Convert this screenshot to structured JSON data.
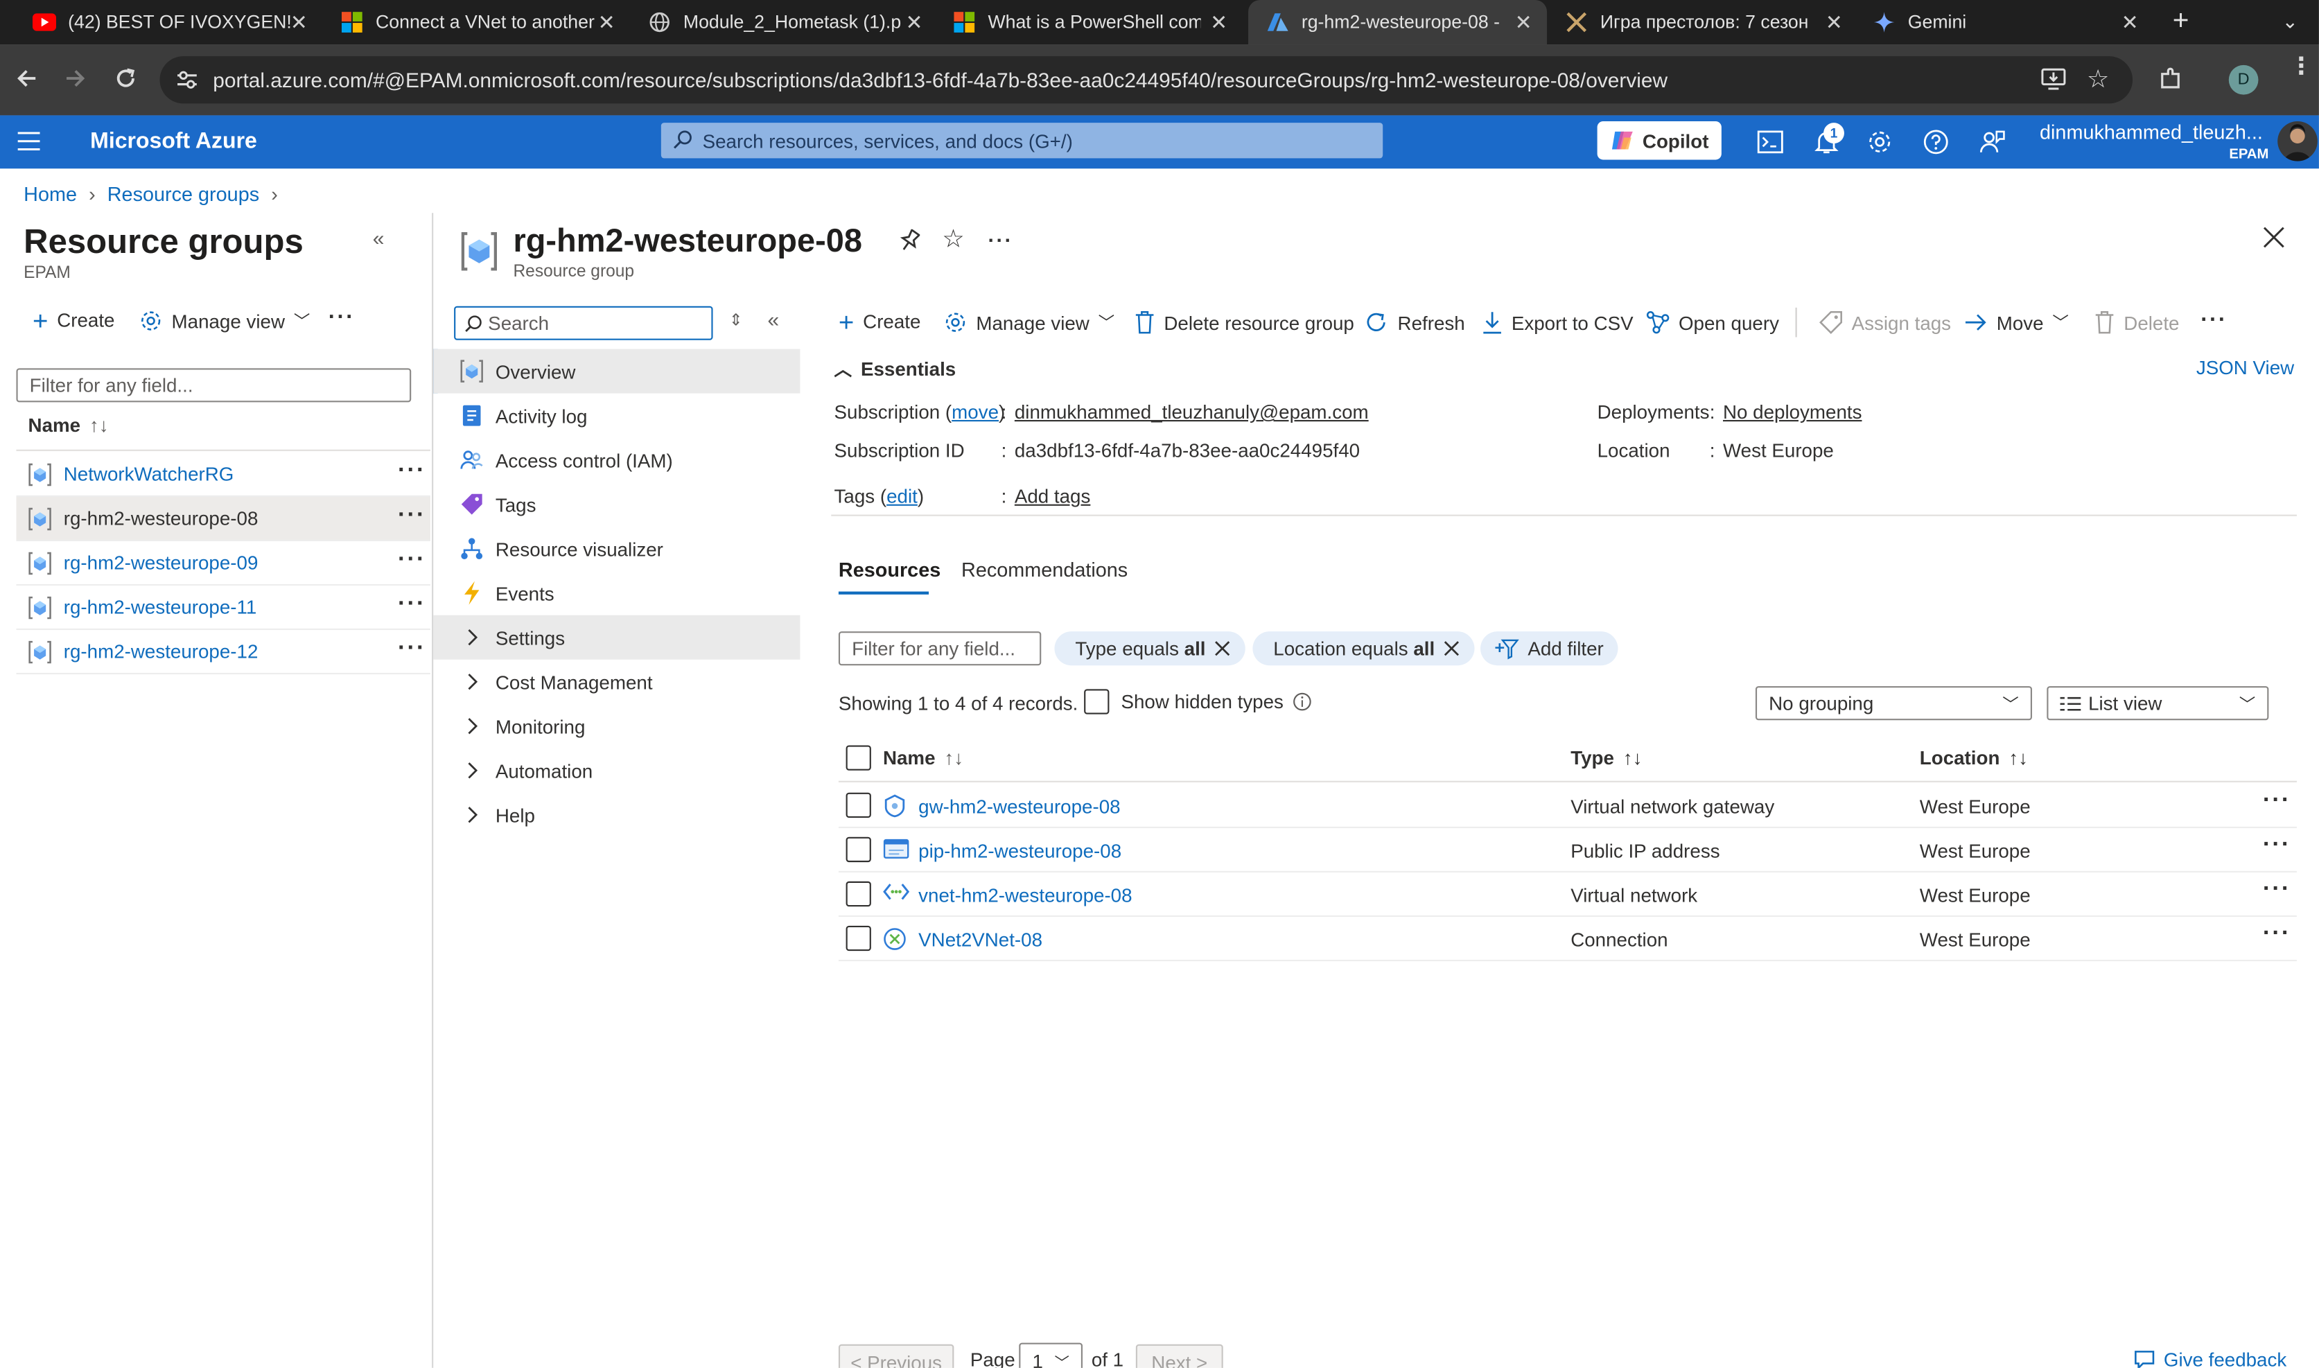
{
  "browser": {
    "tabs": [
      {
        "title": "(42) BEST OF IVOXYGEN!",
        "favicon": "youtube-icon"
      },
      {
        "title": "Connect a VNet to another",
        "favicon": "microsoft-icon"
      },
      {
        "title": "Module_2_Hometask (1).p",
        "favicon": "globe-icon"
      },
      {
        "title": "What is a PowerShell com",
        "favicon": "microsoft-icon"
      },
      {
        "title": "rg-hm2-westeurope-08 -",
        "favicon": "azure-icon"
      },
      {
        "title": "Игра престолов: 7 сезон",
        "favicon": "swords-icon"
      },
      {
        "title": "Gemini",
        "favicon": "gemini-icon"
      }
    ],
    "active_tab": 4,
    "url": "portal.azure.com/#@EPAM.onmicrosoft.com/resource/subscriptions/da3dbf13-6fdf-4a7b-83ee-aa0c24495f40/resourceGroups/rg-hm2-westeurope-08/overview",
    "profile_initial": "D"
  },
  "azure_header": {
    "brand": "Microsoft Azure",
    "search_placeholder": "Search resources, services, and docs (G+/)",
    "copilot_label": "Copilot",
    "notification_count": "1",
    "user_name": "dinmukhammed_tleuzh...",
    "user_org": "EPAM"
  },
  "breadcrumb": [
    "Home",
    "Resource groups"
  ],
  "left_pane": {
    "title": "Resource groups",
    "subtitle": "EPAM",
    "create_label": "Create",
    "manage_view_label": "Manage view",
    "filter_placeholder": "Filter for any field...",
    "column_name": "Name",
    "items": [
      {
        "name": "NetworkWatcherRG",
        "selected": false
      },
      {
        "name": "rg-hm2-westeurope-08",
        "selected": true
      },
      {
        "name": "rg-hm2-westeurope-09",
        "selected": false
      },
      {
        "name": "rg-hm2-westeurope-11",
        "selected": false
      },
      {
        "name": "rg-hm2-westeurope-12",
        "selected": false
      }
    ]
  },
  "resource": {
    "title": "rg-hm2-westeurope-08",
    "subtitle": "Resource group"
  },
  "menu": {
    "search_placeholder": "Search",
    "items": [
      {
        "label": "Overview",
        "icon": "resource-group-icon",
        "type": "item",
        "selected": true
      },
      {
        "label": "Activity log",
        "icon": "activity-log-icon",
        "type": "item"
      },
      {
        "label": "Access control (IAM)",
        "icon": "people-icon",
        "type": "item"
      },
      {
        "label": "Tags",
        "icon": "tag-icon",
        "type": "item"
      },
      {
        "label": "Resource visualizer",
        "icon": "visualizer-icon",
        "type": "item"
      },
      {
        "label": "Events",
        "icon": "lightning-icon",
        "type": "item"
      },
      {
        "label": "Settings",
        "icon": "chevron-right-icon",
        "type": "group",
        "highlight": true
      },
      {
        "label": "Cost Management",
        "icon": "chevron-right-icon",
        "type": "group"
      },
      {
        "label": "Monitoring",
        "icon": "chevron-right-icon",
        "type": "group"
      },
      {
        "label": "Automation",
        "icon": "chevron-right-icon",
        "type": "group"
      },
      {
        "label": "Help",
        "icon": "chevron-right-icon",
        "type": "group"
      }
    ]
  },
  "toolbar": {
    "create": "Create",
    "manage_view": "Manage view",
    "delete_rg": "Delete resource group",
    "refresh": "Refresh",
    "export_csv": "Export to CSV",
    "open_query": "Open query",
    "assign_tags": "Assign tags",
    "move": "Move",
    "delete": "Delete"
  },
  "essentials": {
    "header": "Essentials",
    "json_view": "JSON View",
    "subscription_label": "Subscription",
    "subscription_move": "move",
    "subscription_value": "dinmukhammed_tleuzhanuly@epam.com",
    "subscription_id_label": "Subscription ID",
    "subscription_id_value": "da3dbf13-6fdf-4a7b-83ee-aa0c24495f40",
    "tags_label": "Tags",
    "tags_edit": "edit",
    "tags_value": "Add tags",
    "deployments_label": "Deployments",
    "deployments_value": "No deployments",
    "location_label": "Location",
    "location_value": "West Europe"
  },
  "tabs": {
    "resources": "Resources",
    "recommendations": "Recommendations"
  },
  "filters": {
    "placeholder": "Filter for any field...",
    "type_pill_prefix": "Type equals ",
    "type_pill_value": "all",
    "location_pill_prefix": "Location equals ",
    "location_pill_value": "all",
    "add_filter": "Add filter"
  },
  "records": {
    "showing": "Showing 1 to 4 of 4 records.",
    "show_hidden": "Show hidden types",
    "grouping": "No grouping",
    "view": "List view"
  },
  "table": {
    "columns": {
      "name": "Name",
      "type": "Type",
      "location": "Location"
    },
    "rows": [
      {
        "name": "gw-hm2-westeurope-08",
        "type": "Virtual network gateway",
        "location": "West Europe",
        "icon": "vnet-gateway-icon"
      },
      {
        "name": "pip-hm2-westeurope-08",
        "type": "Public IP address",
        "location": "West Europe",
        "icon": "public-ip-icon"
      },
      {
        "name": "vnet-hm2-westeurope-08",
        "type": "Virtual network",
        "location": "West Europe",
        "icon": "vnet-icon"
      },
      {
        "name": "VNet2VNet-08",
        "type": "Connection",
        "location": "West Europe",
        "icon": "connection-icon"
      }
    ]
  },
  "pagination": {
    "previous": "< Previous",
    "page_label": "Page",
    "page_value": "1",
    "of_label": "of 1",
    "next": "Next >",
    "feedback": "Give feedback"
  }
}
